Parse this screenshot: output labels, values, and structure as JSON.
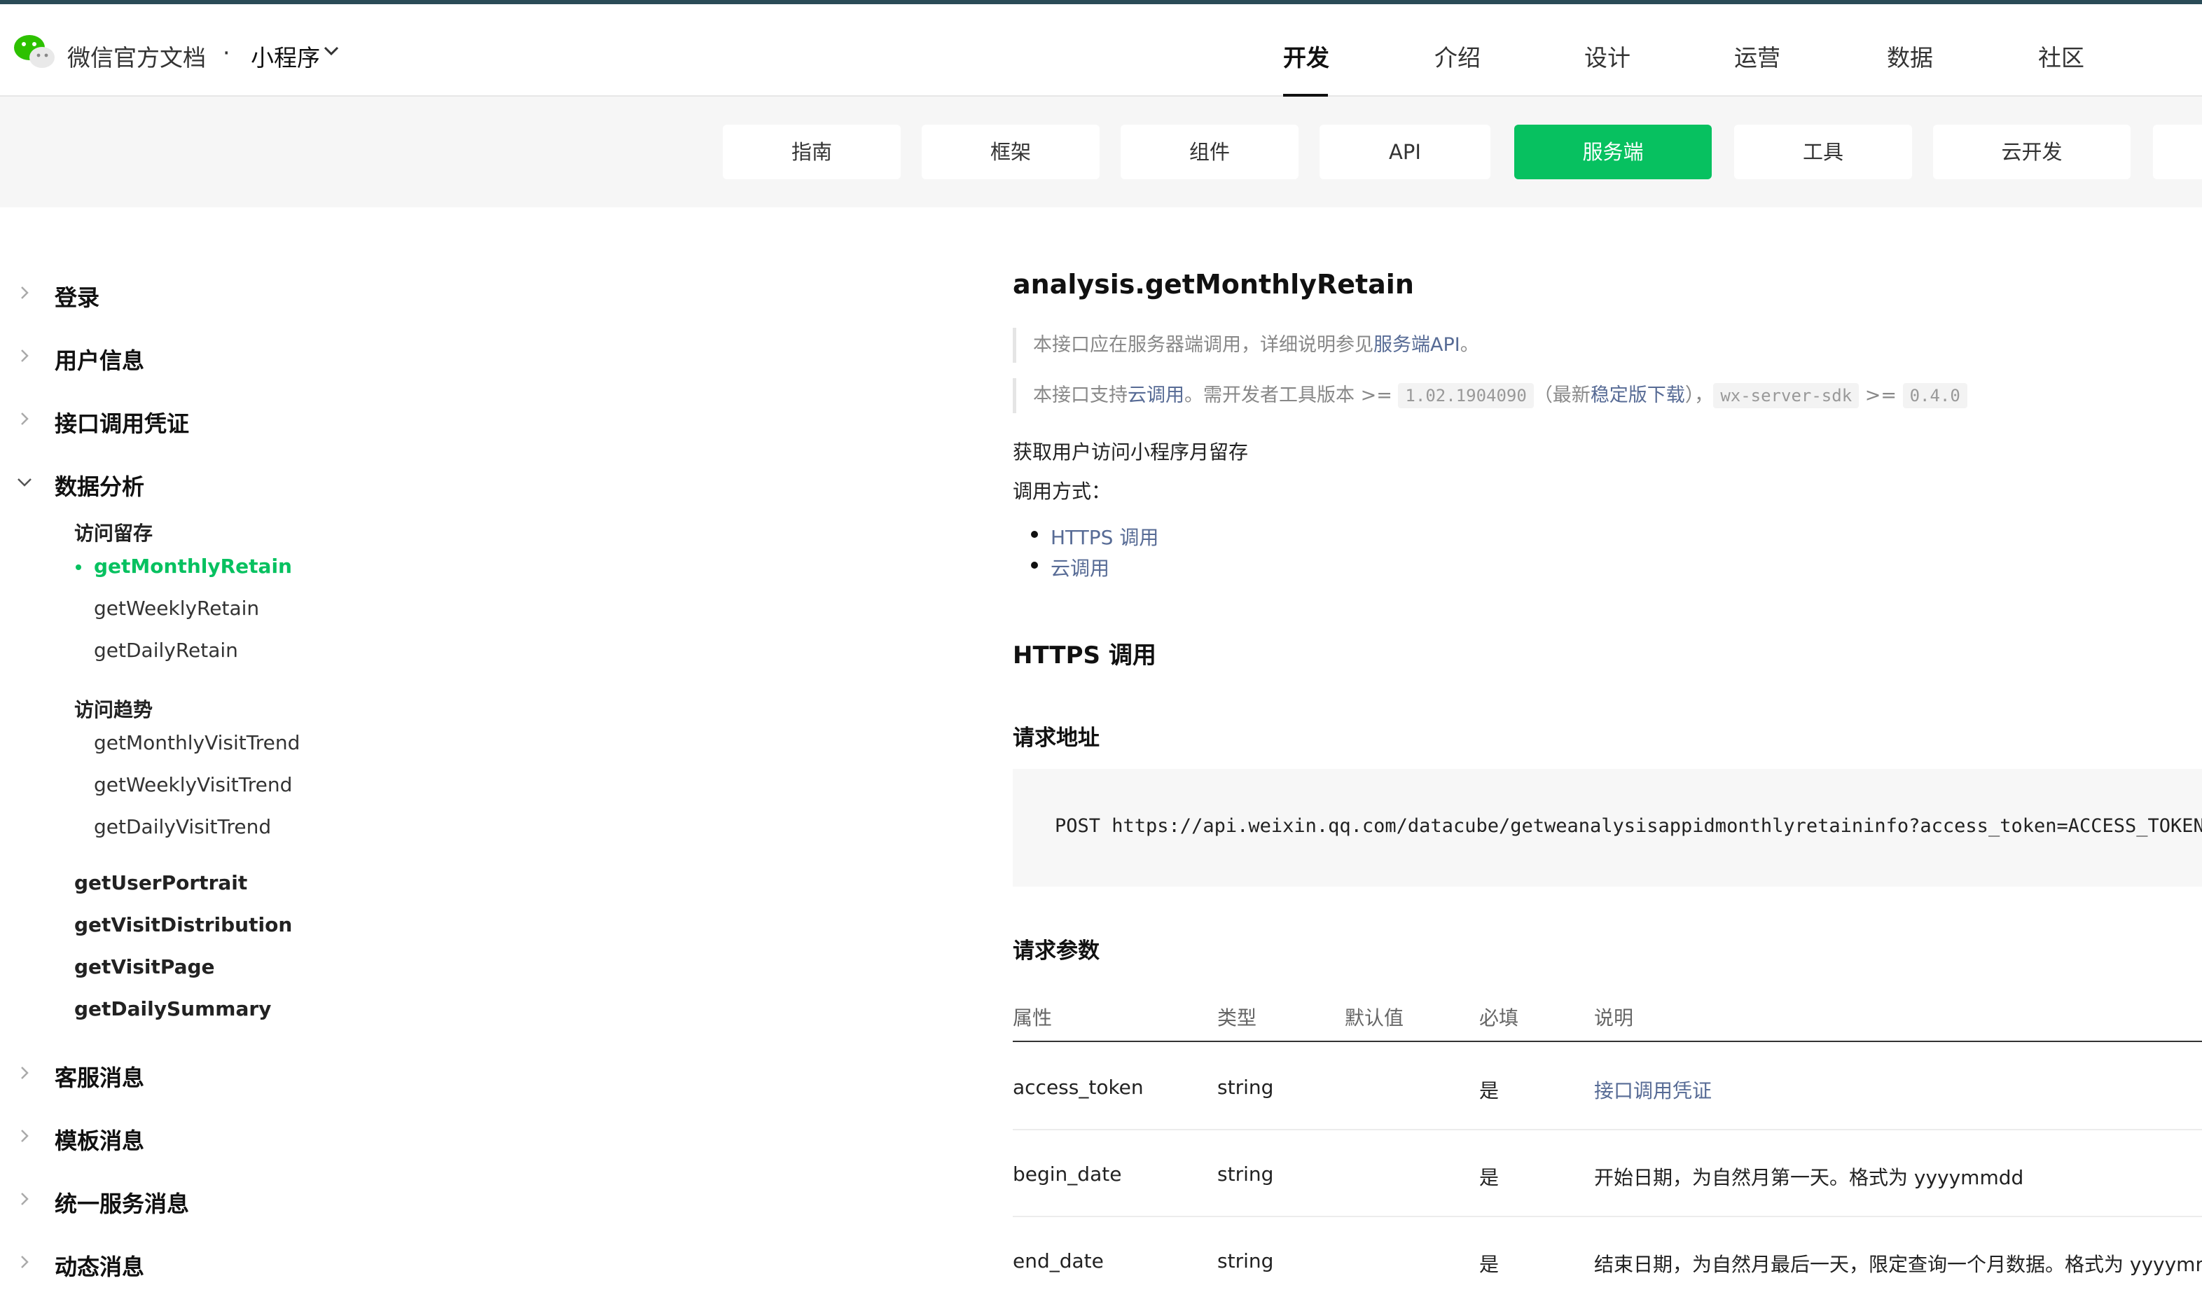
{
  "header": {
    "brand": "微信官方文档",
    "separator": "·",
    "product": "小程序",
    "nav": [
      {
        "label": "开发",
        "active": true
      },
      {
        "label": "介绍"
      },
      {
        "label": "设计"
      },
      {
        "label": "运营"
      },
      {
        "label": "数据"
      },
      {
        "label": "社区"
      }
    ]
  },
  "subnav": {
    "tabs": [
      {
        "label": "指南"
      },
      {
        "label": "框架"
      },
      {
        "label": "组件"
      },
      {
        "label": "API"
      },
      {
        "label": "服务端",
        "active": true
      },
      {
        "label": "工具"
      },
      {
        "label": "云开发"
      }
    ],
    "accent_color": "#07c160"
  },
  "sidebar": {
    "items": [
      {
        "label": "登录"
      },
      {
        "label": "用户信息"
      },
      {
        "label": "接口调用凭证"
      },
      {
        "label": "数据分析",
        "expanded": true
      },
      {
        "label": "客服消息"
      },
      {
        "label": "模板消息"
      },
      {
        "label": "统一服务消息"
      },
      {
        "label": "动态消息"
      }
    ],
    "data_analysis": {
      "group1_title": "访问留存",
      "group1_items": [
        "getMonthlyRetain",
        "getWeeklyRetain",
        "getDailyRetain"
      ],
      "group2_title": "访问趋势",
      "group2_items": [
        "getMonthlyVisitTrend",
        "getWeeklyVisitTrend",
        "getDailyVisitTrend"
      ],
      "other_items": [
        "getUserPortrait",
        "getVisitDistribution",
        "getVisitPage",
        "getDailySummary"
      ]
    }
  },
  "main": {
    "title": "analysis.getMonthlyRetain",
    "note1_prefix": "本接口应在服务器端调用，详细说明参见",
    "note1_link": "服务端API",
    "note1_suffix": "。",
    "note2_prefix": "本接口支持",
    "note2_link1": "云调用",
    "note2_mid": "。需开发者工具版本 >= ",
    "note2_code1": "1.02.1904090",
    "note2_mid2": "（最新",
    "note2_link2": "稳定版下载",
    "note2_mid3": "），",
    "note2_code2": "wx-server-sdk",
    "note2_mid4": " >= ",
    "note2_code3": "0.4.0",
    "desc": "获取用户访问小程序月留存",
    "call_label": "调用方式：",
    "call_methods": [
      "HTTPS 调用",
      "云调用"
    ],
    "section_https": "HTTPS 调用",
    "section_url": "请求地址",
    "request_url": "POST https://api.weixin.qq.com/datacube/getweanalysisappidmonthlyretaininfo?access_token=ACCESS_TOKEN",
    "section_params": "请求参数",
    "table": {
      "headers": [
        "属性",
        "类型",
        "默认值",
        "必填",
        "说明"
      ],
      "rows": [
        {
          "name": "access_token",
          "type": "string",
          "default": "",
          "required": "是",
          "desc": "接口调用凭证",
          "desc_is_link": true
        },
        {
          "name": "begin_date",
          "type": "string",
          "default": "",
          "required": "是",
          "desc": "开始日期，为自然月第一天。格式为 yyyymmdd"
        },
        {
          "name": "end_date",
          "type": "string",
          "default": "",
          "required": "是",
          "desc": "结束日期，为自然月最后一天，限定查询一个月数据。格式为 yyyymmdd"
        }
      ]
    }
  }
}
